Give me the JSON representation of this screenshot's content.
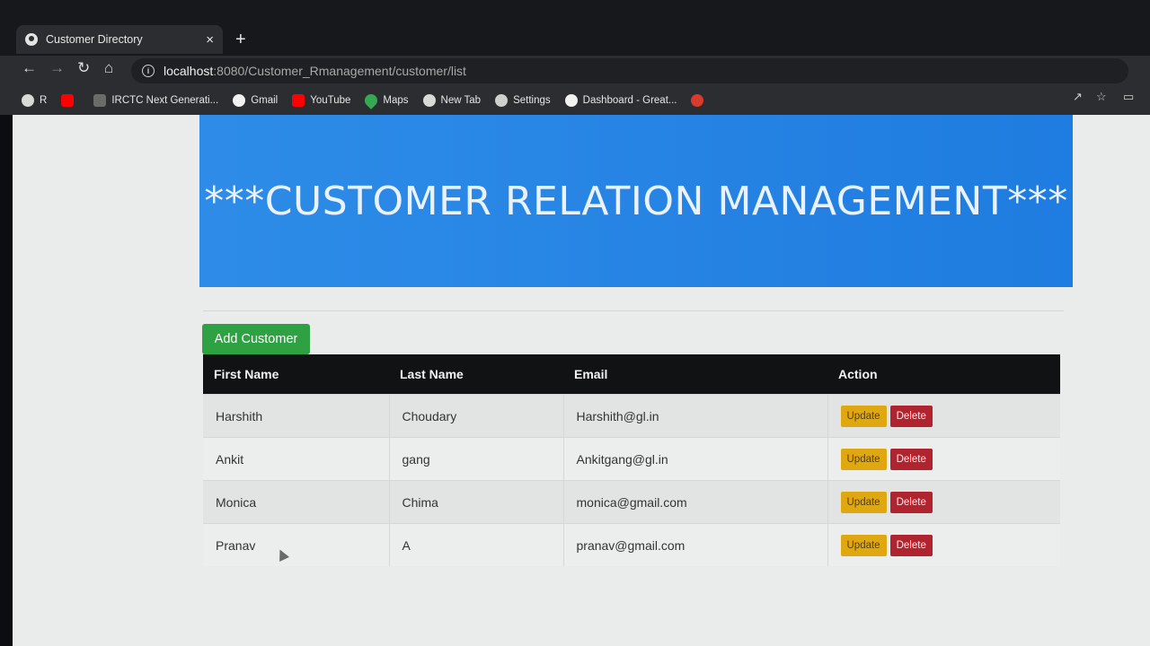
{
  "browser": {
    "tab_title": "Customer Directory",
    "tab_close": "×",
    "new_tab": "+",
    "url_host": "localhost",
    "url_rest": ":8080/Customer_Rmanagement/customer/list",
    "bookmarks": [
      {
        "label": "R",
        "icon": "globe-icon"
      },
      {
        "label": "",
        "icon": "youtube-icon"
      },
      {
        "label": "IRCTC Next Generati...",
        "icon": "irctc-icon"
      },
      {
        "label": "Gmail",
        "icon": "google-icon"
      },
      {
        "label": "YouTube",
        "icon": "youtube-icon"
      },
      {
        "label": "Maps",
        "icon": "maps-icon"
      },
      {
        "label": "New Tab",
        "icon": "globe-icon"
      },
      {
        "label": "Settings",
        "icon": "gear-icon"
      },
      {
        "label": "Dashboard - Great...",
        "icon": "google-icon"
      },
      {
        "label": "",
        "icon": "red-circle-icon"
      }
    ]
  },
  "banner": {
    "title": "***CUSTOMER RELATION MANAGEMENT***"
  },
  "actions": {
    "add_label": "Add Customer"
  },
  "table": {
    "headers": [
      "First Name",
      "Last Name",
      "Email",
      "Action"
    ],
    "update_label": "Update",
    "delete_label": "Delete",
    "rows": [
      {
        "first": "Harshith",
        "last": "Choudary",
        "email": "Harshith@gl.in"
      },
      {
        "first": "Ankit",
        "last": "gang",
        "email": "Ankitgang@gl.in"
      },
      {
        "first": "Monica",
        "last": "Chima",
        "email": "monica@gmail.com"
      },
      {
        "first": "Pranav",
        "last": "A",
        "email": "pranav@gmail.com"
      }
    ]
  },
  "colors": {
    "banner": "#1f7ce0",
    "add_button": "#2ea143",
    "update_button": "#e0a810",
    "delete_button": "#b0242f",
    "table_header": "#111214"
  }
}
